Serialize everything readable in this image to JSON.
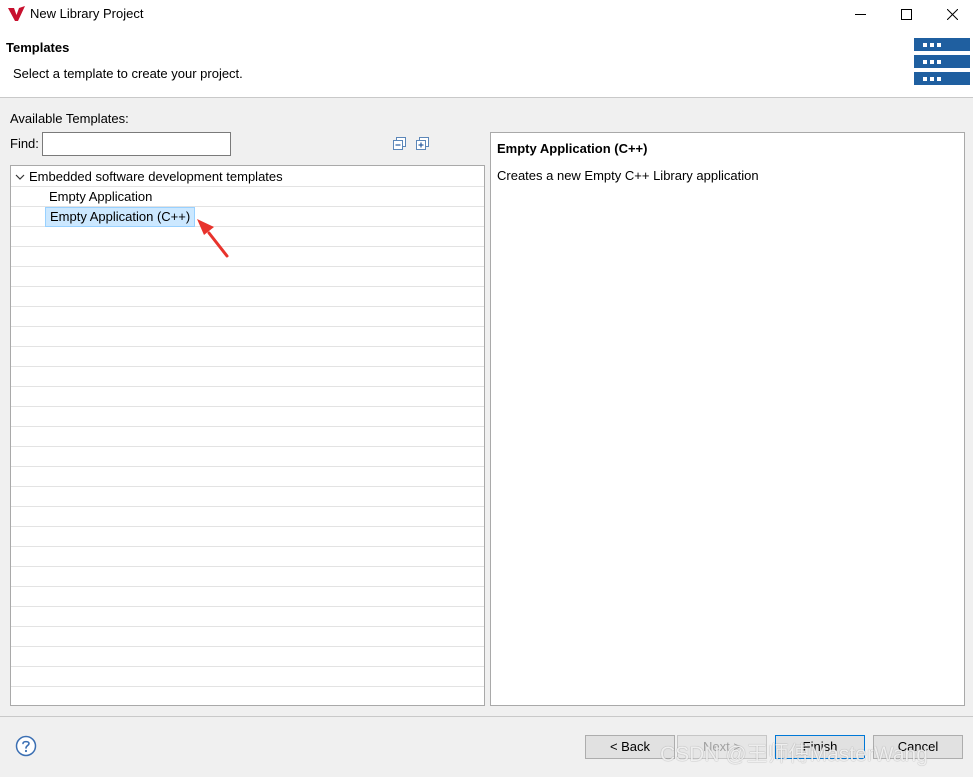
{
  "window": {
    "title": "New Library Project"
  },
  "header": {
    "title": "Templates",
    "description": "Select a template to create your project."
  },
  "templates": {
    "available_label": "Available Templates:",
    "find_label": "Find:",
    "find_value": "",
    "tree": {
      "category": "Embedded software development templates",
      "items": [
        "Empty Application",
        "Empty Application (C++)"
      ],
      "selected": "Empty Application (C++)"
    }
  },
  "description_panel": {
    "title": "Empty Application (C++)",
    "text": "Creates a new Empty C++ Library application"
  },
  "buttons": {
    "back": "< Back",
    "next": "Next >",
    "finish": "Finish",
    "cancel": "Cancel"
  },
  "watermark": "CSDN @王师傅MasterWang",
  "colors": {
    "selection": "#cce8ff",
    "annotation_arrow": "#e8332c",
    "header_icon": "#1f5fa0",
    "finish_border": "#0078d7"
  }
}
